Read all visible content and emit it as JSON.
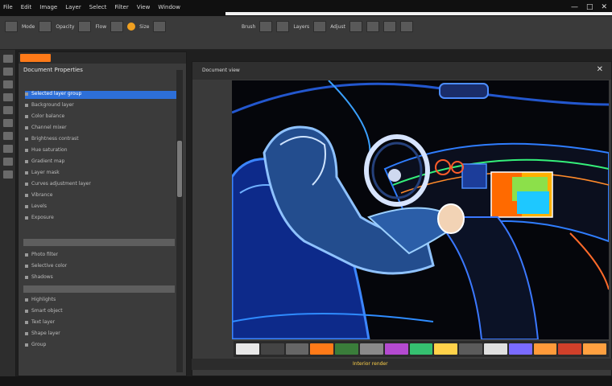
{
  "window": {
    "menu": [
      "File",
      "Edit",
      "Image",
      "Layer",
      "Select",
      "Filter",
      "View",
      "Window"
    ],
    "controls": [
      "minimize-icon",
      "maximize-icon",
      "close-icon"
    ]
  },
  "toolbar": {
    "labels": [
      "Mode",
      "Opacity",
      "Flow",
      "Size",
      "Brush",
      "Layers",
      "Adjust"
    ]
  },
  "left_panel": {
    "tab_label": "",
    "header": "Document Properties",
    "items": [
      {
        "label": "Selected layer group",
        "selected": true
      },
      {
        "label": "Background layer"
      },
      {
        "label": "Color balance"
      },
      {
        "label": "Channel mixer"
      },
      {
        "label": "Brightness contrast"
      },
      {
        "label": "Hue saturation"
      },
      {
        "label": "Gradient map"
      },
      {
        "label": "Layer mask"
      },
      {
        "label": "Curves adjustment layer"
      },
      {
        "label": "Vibrance"
      },
      {
        "label": "Levels"
      },
      {
        "label": "Exposure"
      },
      {
        "label": "Photo filter"
      },
      {
        "label": "Selective color"
      },
      {
        "label": "Shadows"
      },
      {
        "label": "Highlights"
      },
      {
        "label": "Smart object"
      },
      {
        "label": "Text layer"
      },
      {
        "label": "Shape layer"
      },
      {
        "label": "Group"
      }
    ]
  },
  "canvas": {
    "title": "Document view",
    "accent": "#2f8cff"
  },
  "statusbar": {
    "text": "Interior render"
  },
  "colors": {
    "accent_orange": "#ff7a18",
    "selection_blue": "#2d6fd8",
    "neon_blue": "#3a8dff",
    "neon_green": "#35f07a"
  }
}
